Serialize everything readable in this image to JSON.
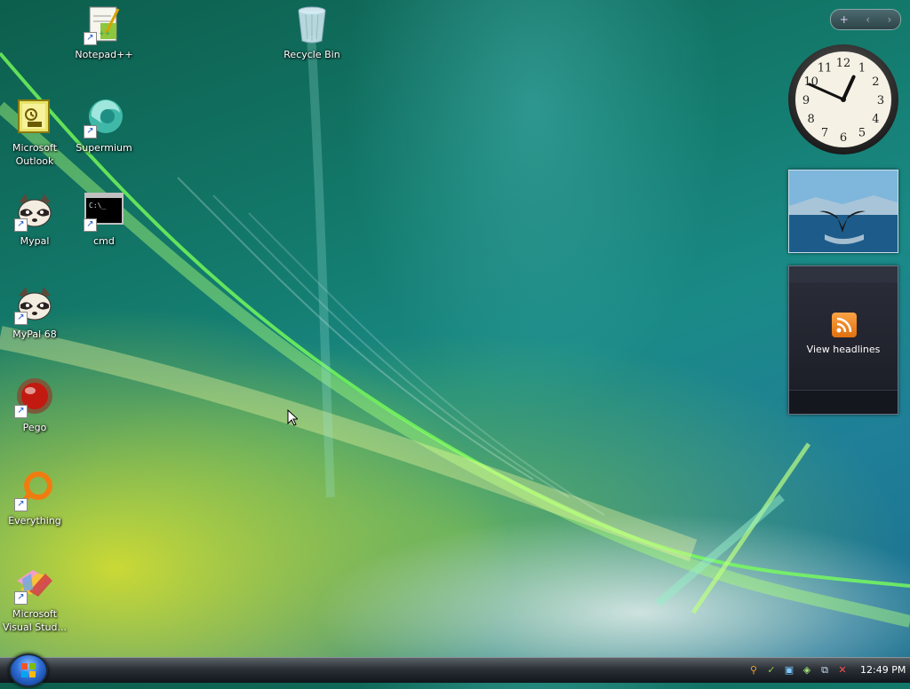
{
  "desktop": {
    "icons": [
      {
        "label": "Notepad++",
        "icon": "notepad-plus-plus-icon",
        "shortcut": true
      },
      {
        "label": "Recycle Bin",
        "icon": "recycle-bin-icon",
        "shortcut": false
      },
      {
        "label": "Microsoft Outlook",
        "icon": "outlook-icon",
        "shortcut": false
      },
      {
        "label": "Supermium",
        "icon": "supermium-browser-icon",
        "shortcut": true
      },
      {
        "label": "Mypal",
        "icon": "mypal-raccoon-icon",
        "shortcut": true
      },
      {
        "label": "cmd",
        "icon": "command-prompt-icon",
        "shortcut": true,
        "glyph_text": "C:\\_"
      },
      {
        "label": "MyPal 68",
        "icon": "mypal-raccoon-icon",
        "shortcut": true
      },
      {
        "label": "Pego",
        "icon": "pego-red-ball-icon",
        "shortcut": true
      },
      {
        "label": "Everything",
        "icon": "everything-search-icon",
        "shortcut": true
      },
      {
        "label": "Microsoft Visual Stud...",
        "icon": "visual-studio-icon",
        "shortcut": true
      }
    ]
  },
  "sidebar": {
    "controls": {
      "add": "+",
      "prev": "‹",
      "next": "›"
    },
    "clock": {
      "numbers": [
        "12",
        "1",
        "2",
        "3",
        "4",
        "5",
        "6",
        "7",
        "8",
        "9",
        "10",
        "11"
      ],
      "hour": 12,
      "minute": 49
    },
    "slideshow": {
      "subject": "whale-tail-photo"
    },
    "feed": {
      "label": "View headlines",
      "icon": "rss-icon"
    }
  },
  "taskbar": {
    "start_icon": "windows-start-orb",
    "tray_icons": [
      "search-tray-icon",
      "security-check-icon",
      "network-tray-icon",
      "network-status-icon",
      "display-tray-icon",
      "volume-muted-icon"
    ],
    "time": "12:49 PM"
  },
  "colors": {
    "taskbar_top": "#5a6268",
    "taskbar_bottom": "#10161b",
    "feed_icon": "#f08a24",
    "label_text": "#ffffff"
  }
}
